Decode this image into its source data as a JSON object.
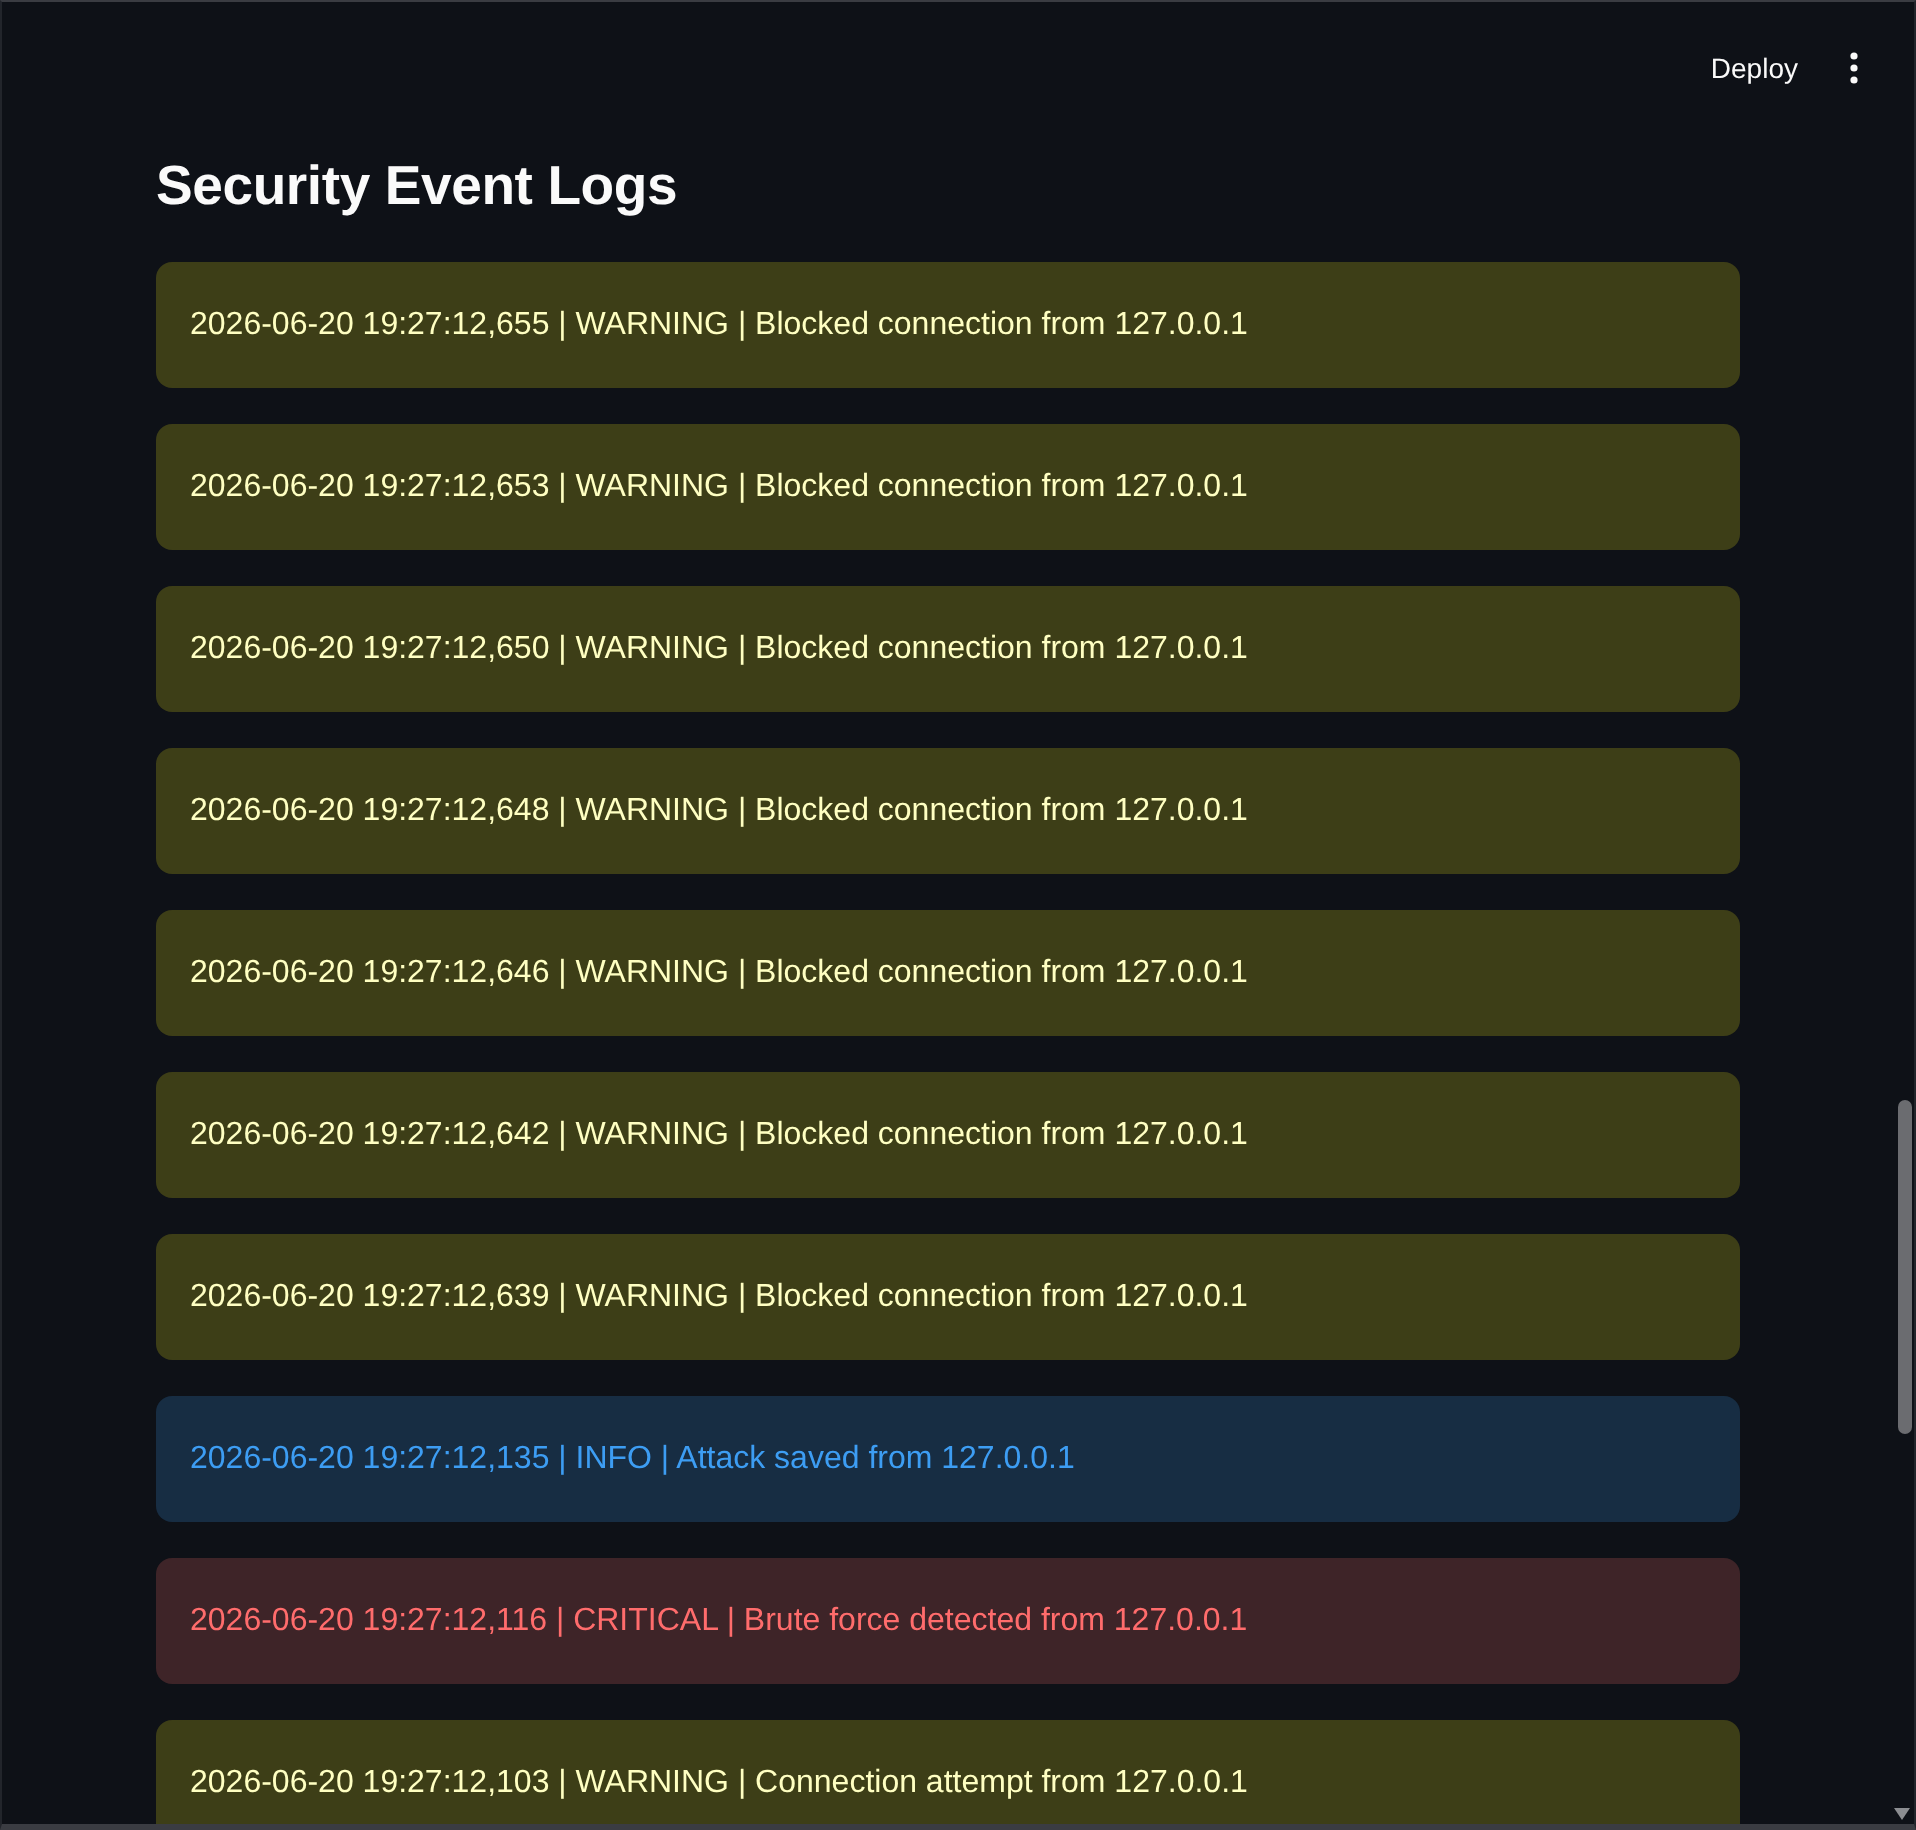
{
  "header": {
    "deploy_label": "Deploy"
  },
  "title": "Security Event Logs",
  "logs": [
    {
      "kind": "warning",
      "text": "2026-06-20 19:27:12,655 | WARNING | Blocked connection from 127.0.0.1"
    },
    {
      "kind": "warning",
      "text": "2026-06-20 19:27:12,653 | WARNING | Blocked connection from 127.0.0.1"
    },
    {
      "kind": "warning",
      "text": "2026-06-20 19:27:12,650 | WARNING | Blocked connection from 127.0.0.1"
    },
    {
      "kind": "warning",
      "text": "2026-06-20 19:27:12,648 | WARNING | Blocked connection from 127.0.0.1"
    },
    {
      "kind": "warning",
      "text": "2026-06-20 19:27:12,646 | WARNING | Blocked connection from 127.0.0.1"
    },
    {
      "kind": "warning",
      "text": "2026-06-20 19:27:12,642 | WARNING | Blocked connection from 127.0.0.1"
    },
    {
      "kind": "warning",
      "text": "2026-06-20 19:27:12,639 | WARNING | Blocked connection from 127.0.0.1"
    },
    {
      "kind": "info",
      "text": "2026-06-20 19:27:12,135 | INFO | Attack saved from 127.0.0.1"
    },
    {
      "kind": "critical",
      "text": "2026-06-20 19:27:12,116 | CRITICAL | Brute force detected from 127.0.0.1"
    },
    {
      "kind": "warning",
      "text": "2026-06-20 19:27:12,103 | WARNING | Connection attempt from 127.0.0.1"
    }
  ]
}
